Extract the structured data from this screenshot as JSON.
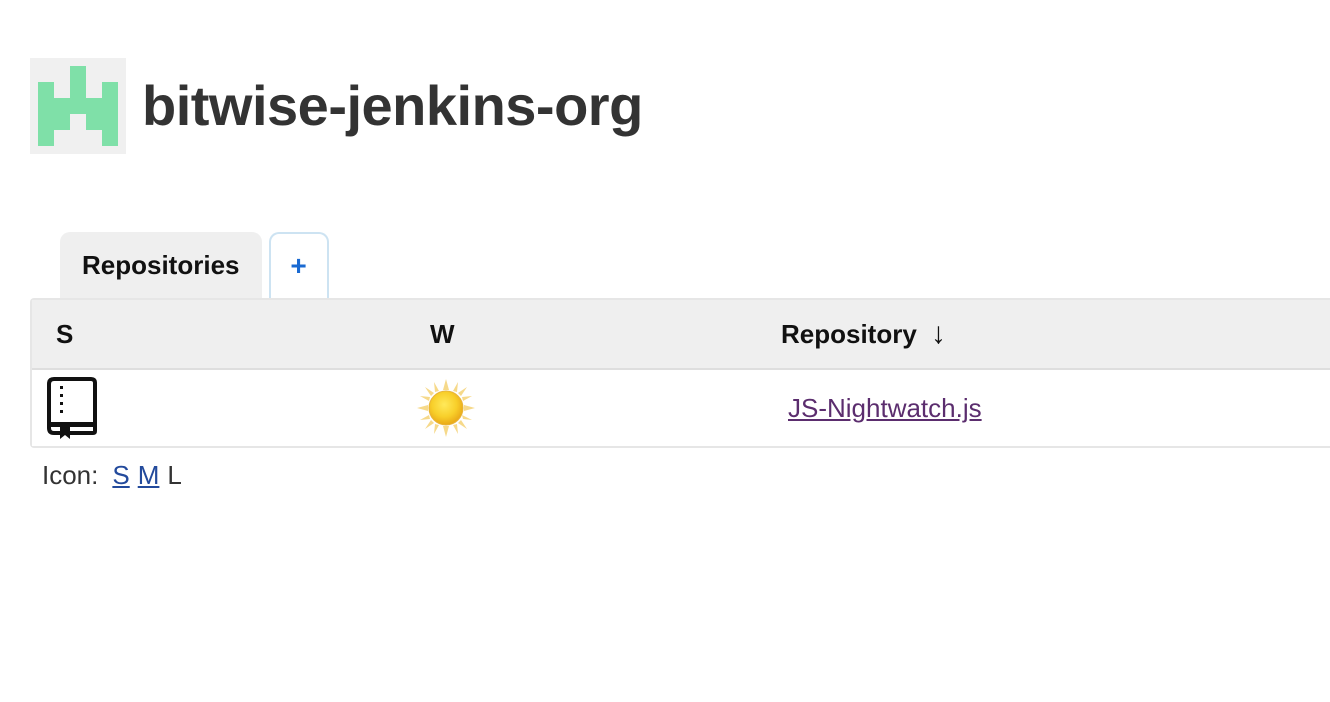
{
  "header": {
    "title": "bitwise-jenkins-org",
    "avatar_icon": "identicon-avatar",
    "avatar_color": "#7fe0a8"
  },
  "tabs": [
    {
      "label": "Repositories",
      "active": true
    },
    {
      "label": "+",
      "active": false
    }
  ],
  "table": {
    "columns": [
      "S",
      "W",
      "Repository"
    ],
    "sort_indicator": "↓",
    "rows": [
      {
        "status_icon": "repository-book-icon",
        "weather_icon": "sunny-weather-icon",
        "repository": "JS-Nightwatch.js"
      }
    ]
  },
  "icon_sizes": {
    "label": "Icon:",
    "options": [
      "S",
      "M",
      "L"
    ],
    "current": "L"
  },
  "colors": {
    "link": "#234a9c",
    "visited_link": "#5b2d6e",
    "add_tab": "#1a6ad2"
  }
}
